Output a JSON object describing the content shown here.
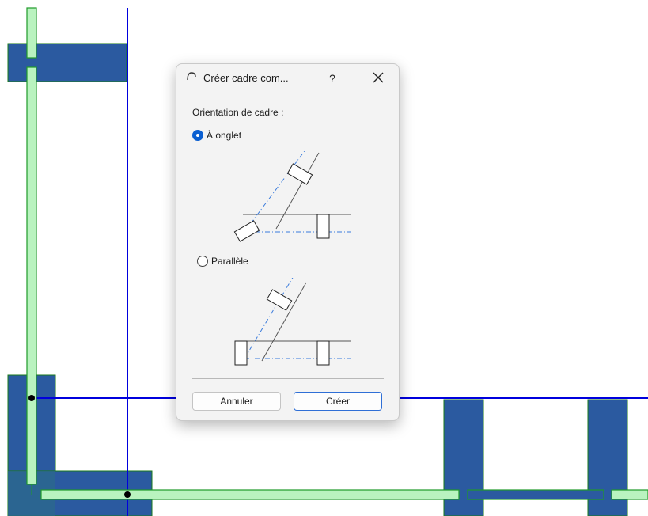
{
  "dialog": {
    "title": "Créer cadre com...",
    "help_label": "?",
    "orientation_label": "Orientation de cadre :",
    "options": [
      {
        "label": "À onglet",
        "selected": true
      },
      {
        "label": "Parallèle",
        "selected": false
      }
    ],
    "buttons": {
      "cancel": "Annuler",
      "create": "Créer"
    }
  },
  "colors": {
    "grid_line": "#0000dd",
    "wall_fill": "#2b5aa0",
    "wall_edge": "#1a7a1a",
    "frame_fill": "#b9f3bf",
    "frame_edge": "#1f9a2a",
    "accent": "#0a5fd1",
    "dash_line": "#3a7bdc"
  },
  "icons": {
    "title": "frame-arc-icon",
    "close": "close-icon"
  }
}
